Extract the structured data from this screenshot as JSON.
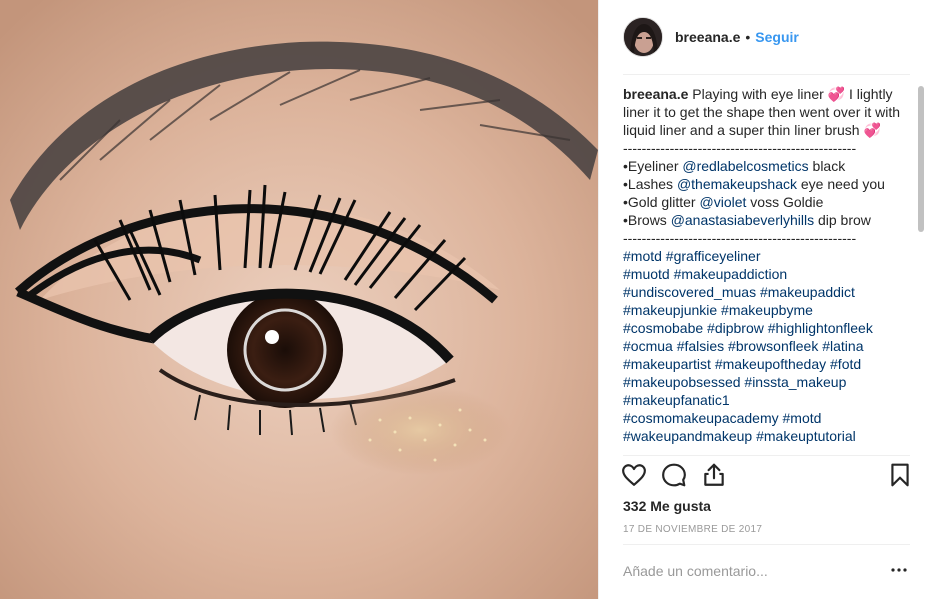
{
  "post": {
    "username": "breeana.e",
    "separator": "•",
    "follow_label": "Seguir",
    "caption_username": "breeana.e",
    "caption_text": "Playing with eye liner 💞 I lightly liner it to get the shape then went over it with liquid liner and a super thin liner brush 💞",
    "divider_top": "--------------------------------------------------",
    "products": [
      {
        "prefix": "•Eyeliner ",
        "mention": "@redlabelcosmetics",
        "suffix": " black"
      },
      {
        "prefix": "•Lashes ",
        "mention": "@themakeupshack",
        "suffix": " eye need you"
      },
      {
        "prefix": "•Gold glitter ",
        "mention": "@violet",
        "suffix": " voss Goldie"
      },
      {
        "prefix": "•Brows ",
        "mention": "@anastasiabeverlyhills",
        "suffix": " dip brow"
      }
    ],
    "divider_bottom": "--------------------------------------------------",
    "hashtag_lines": [
      "#motd #grafficeyeliner",
      "#muotd #makeupaddiction",
      "#undiscovered_muas #makeupaddict",
      "#makeupjunkie #makeupbyme",
      "#cosmobabe #dipbrow #highlightonfleek",
      "#ocmua #falsies #browsonfleek #latina",
      "#makeupartist #makeupoftheday #fotd",
      "#makeupobsessed #inssta_makeup",
      "#makeupfanatic1",
      "#cosmomakeupacademy #motd",
      "#wakeupandmakeup #makeuptutorial"
    ],
    "likes": "332 Me gusta",
    "date": "17 DE NOVIEMBRE DE 2017",
    "comment_placeholder": "Añade un comentario...",
    "icons": {
      "like": "heart-icon",
      "comment": "comment-icon",
      "share": "share-icon",
      "save": "bookmark-icon",
      "more": "more-options-icon"
    },
    "colors": {
      "follow": "#3897f0",
      "link": "#003569",
      "text": "#262626",
      "muted": "#999999"
    }
  }
}
